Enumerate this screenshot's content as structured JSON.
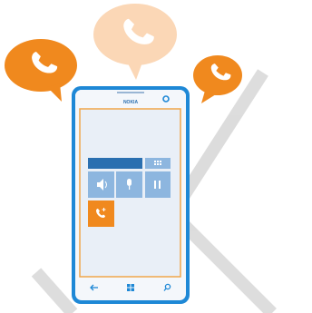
{
  "phone": {
    "brand": "NOKIA"
  },
  "colors": {
    "phone_body": "#1e88d6",
    "phone_body_dark": "#1470b8",
    "screen_bg": "#e9eff7",
    "screen_border": "#f0a64a",
    "tile_dark": "#2a6fb0",
    "tile_light": "#8db6df",
    "tile_accent": "#f0891e",
    "bubble_orange": "#f0891e",
    "bubble_peach": "#fbd7b6",
    "watermark": "#d9d9d9"
  },
  "icons": [
    "phone-icon",
    "speaker-icon",
    "microphone-icon",
    "pause-icon",
    "keypad-icon",
    "add-call-icon",
    "back-icon",
    "windows-icon",
    "search-icon"
  ]
}
